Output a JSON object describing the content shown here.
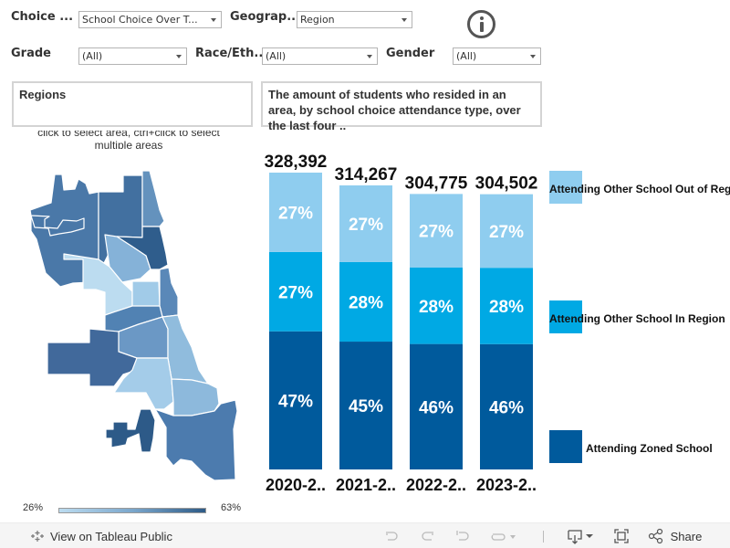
{
  "filters": {
    "choice": {
      "label": "Choice ...",
      "value": "School Choice Over T..."
    },
    "geography": {
      "label": "Geograp...",
      "value": "Region"
    },
    "grade": {
      "label": "Grade",
      "value": "(All)"
    },
    "race": {
      "label": "Race/Eth...",
      "value": "(All)"
    },
    "gender": {
      "label": "Gender",
      "value": "(All)"
    }
  },
  "info_icon": "info-circle-icon",
  "regions_box": {
    "title": "Regions"
  },
  "description_box": {
    "text": "The amount of students who resided in an area, by school choice attendance type, over the last four .."
  },
  "map_hint": "click to select area, ctrl+click to select multiple areas",
  "map": {
    "color_ramp": {
      "min_label": "26%",
      "max_label": "63%",
      "min_color": "#bcdcf0",
      "max_color": "#2e5b87"
    }
  },
  "chart_data": {
    "type": "bar",
    "stacked": true,
    "title": "",
    "xlabel": "",
    "ylabel": "",
    "categories": [
      "2020-2..",
      "2021-2..",
      "2022-2..",
      "2023-2.."
    ],
    "totals": [
      328392,
      314267,
      304775,
      304502
    ],
    "total_labels": [
      "328,392",
      "314,267",
      "304,775",
      "304,502"
    ],
    "series": [
      {
        "name": "Attending Zoned School",
        "values": [
          47,
          45,
          46,
          46
        ],
        "labels": [
          "47%",
          "45%",
          "46%",
          "46%"
        ],
        "color": "#005a9c"
      },
      {
        "name": "Attending Other School In Region",
        "values": [
          27,
          28,
          28,
          28
        ],
        "labels": [
          "27%",
          "28%",
          "28%",
          "28%"
        ],
        "color": "#00a9e4"
      },
      {
        "name": "Attending Other School Out of Reg",
        "values": [
          27,
          27,
          27,
          27
        ],
        "labels": [
          "27%",
          "27%",
          "27%",
          "27%"
        ],
        "color": "#8fcdef"
      }
    ],
    "legend_position": "right",
    "grid": false
  },
  "legend": [
    {
      "label": "Attending Other School Out of Reg",
      "color": "#8fcdef"
    },
    {
      "label": "Attending Other School In Region",
      "color": "#00a9e4"
    },
    {
      "label": "Attending Zoned School",
      "color": "#005a9c"
    }
  ],
  "footer": {
    "view_link": "View on Tableau Public",
    "share_label": "Share"
  }
}
